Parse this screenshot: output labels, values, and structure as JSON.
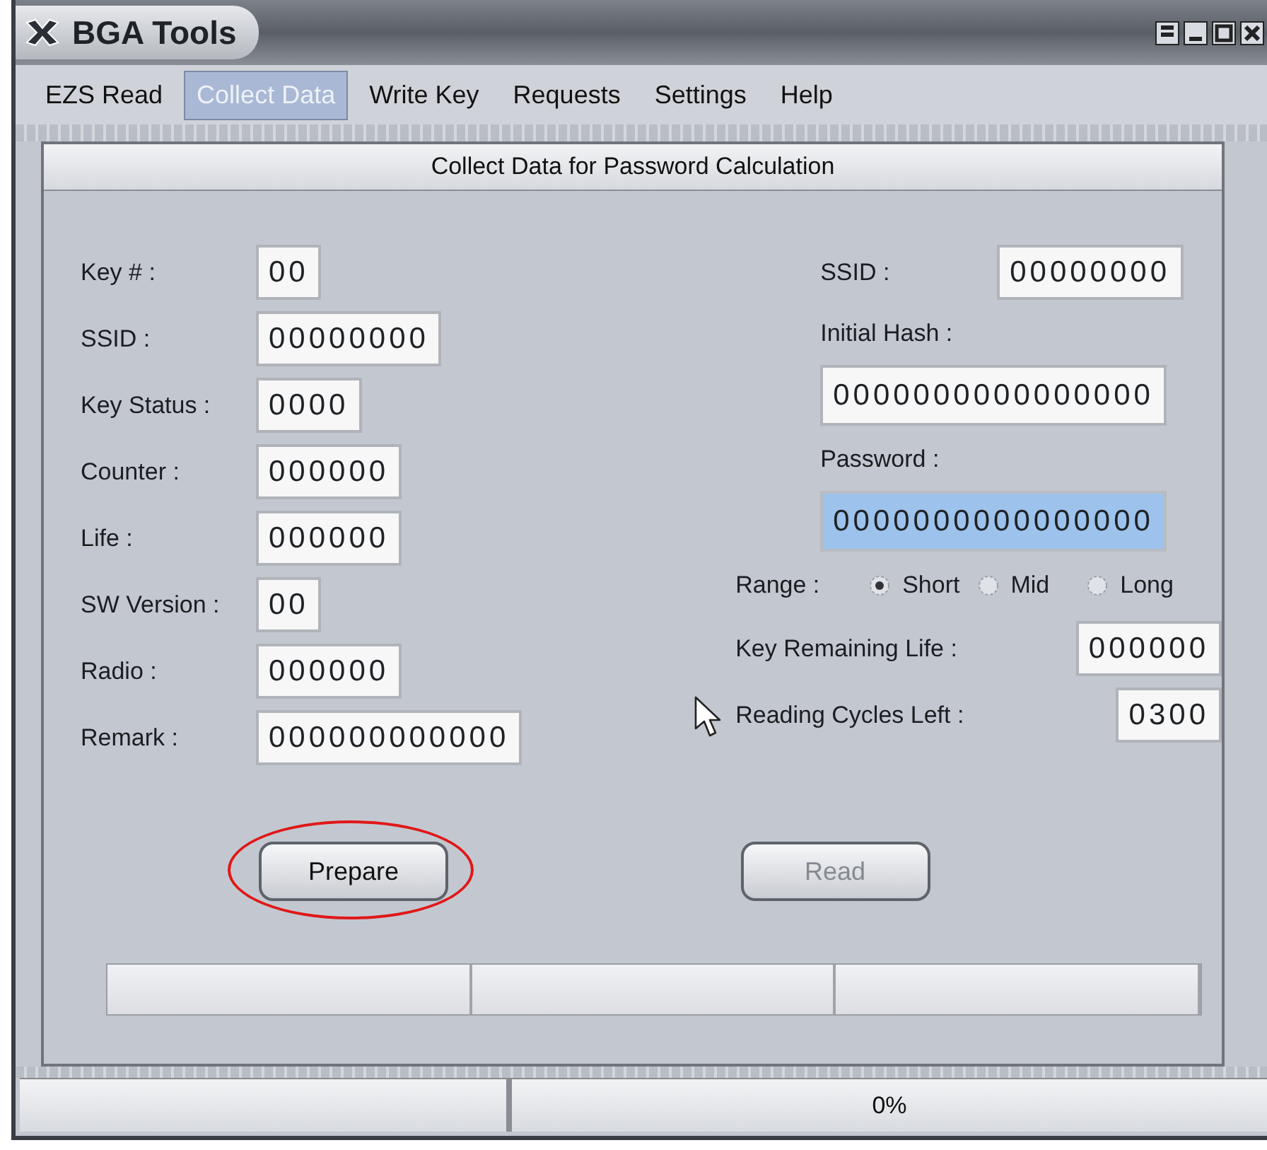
{
  "window": {
    "title": "BGA Tools"
  },
  "window_buttons": [
    {
      "kind": "restore"
    },
    {
      "kind": "minimize"
    },
    {
      "kind": "maximize"
    },
    {
      "kind": "close"
    }
  ],
  "menu": [
    {
      "label": "EZS Read",
      "selected": false
    },
    {
      "label": "Collect Data",
      "selected": true
    },
    {
      "label": "Write Key",
      "selected": false
    },
    {
      "label": "Requests",
      "selected": false
    },
    {
      "label": "Settings",
      "selected": false
    },
    {
      "label": "Help",
      "selected": false
    }
  ],
  "panel": {
    "title": "Collect Data for Password Calculation",
    "left_fields": [
      {
        "label": "Key # :",
        "value": "00"
      },
      {
        "label": "SSID :",
        "value": "00000000"
      },
      {
        "label": "Key Status :",
        "value": "0000"
      },
      {
        "label": "Counter :",
        "value": "000000"
      },
      {
        "label": "Life :",
        "value": "000000"
      },
      {
        "label": "SW Version :",
        "value": "00"
      },
      {
        "label": "Radio :",
        "value": "000000"
      },
      {
        "label": "Remark :",
        "value": "000000000000"
      }
    ],
    "right_fields": [
      {
        "kind": "inline",
        "label": "SSID :",
        "value": "00000000",
        "highlighted": false
      },
      {
        "kind": "stacked",
        "label": "Initial Hash :",
        "value": "0000000000000000",
        "highlighted": false
      },
      {
        "kind": "stacked",
        "label": "Password :",
        "value": "0000000000000000",
        "highlighted": true
      }
    ],
    "range": {
      "label": "Range :",
      "options": [
        {
          "label": "Short",
          "selected": true
        },
        {
          "label": "Mid",
          "selected": false
        },
        {
          "label": "Long",
          "selected": false
        }
      ]
    },
    "bottom_fields": [
      {
        "label": "Key Remaining Life :",
        "value": "000000"
      },
      {
        "label": "Reading Cycles Left :",
        "value": "0300"
      }
    ],
    "buttons": [
      {
        "label": "Prepare",
        "disabled": false,
        "circled": true
      },
      {
        "label": "Read",
        "disabled": true,
        "circled": false
      }
    ]
  },
  "progress_bar": {
    "level": 0
  },
  "status_bar": {
    "progress": "0%",
    "level": 0
  }
}
